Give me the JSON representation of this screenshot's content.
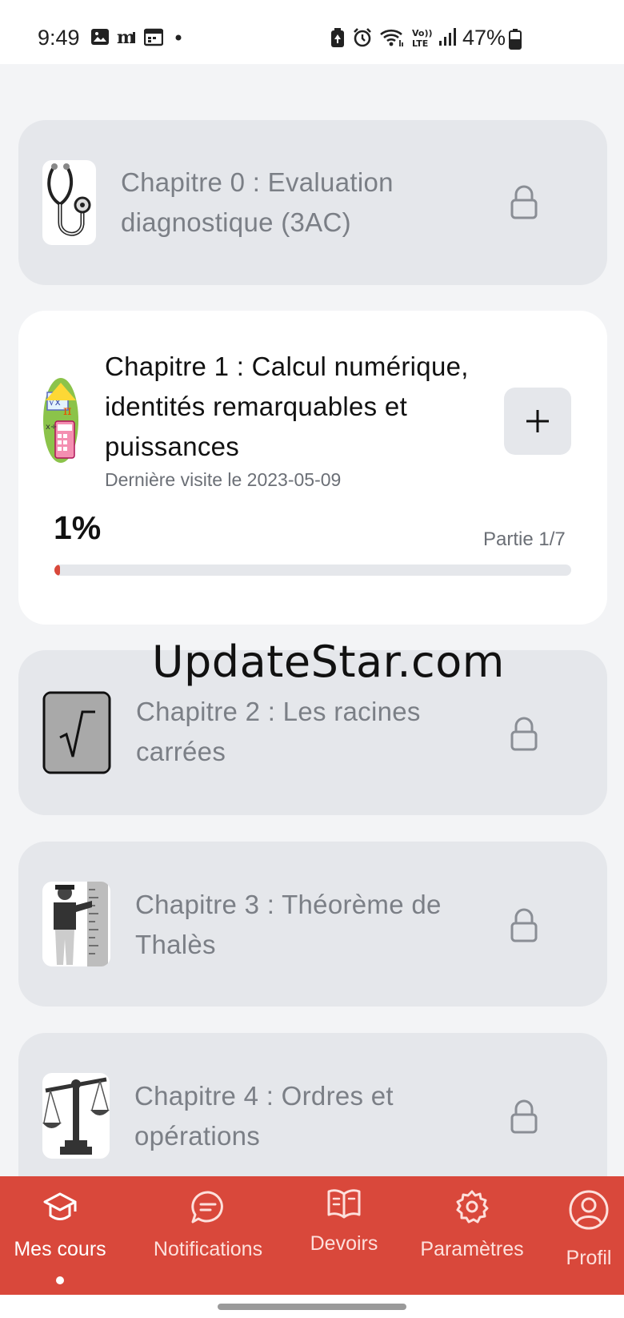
{
  "status_bar": {
    "time": "9:49",
    "battery_percent": "47%"
  },
  "chapters": [
    {
      "title": "Chapitre 0 : Evaluation diagnostique (3AC)",
      "locked": true,
      "icon": "stethoscope-icon"
    },
    {
      "title": "Chapitre 1 : Calcul numérique, identités remarquables et puissances",
      "locked": false,
      "icon": "calculator-math-icon",
      "last_visit": "Dernière visite le 2023-05-09",
      "progress_label": "1%",
      "progress_fraction": 0.01,
      "part_label": "Partie 1/7",
      "action_icon": "plus-icon"
    },
    {
      "title": "Chapitre 2 : Les racines carrées",
      "locked": true,
      "icon": "square-root-icon"
    },
    {
      "title": "Chapitre 3 : Théorème de Thalès",
      "locked": true,
      "icon": "measuring-person-icon"
    },
    {
      "title": "Chapitre 4 : Ordres et opérations",
      "locked": true,
      "icon": "balance-scale-icon"
    }
  ],
  "watermark": "UpdateStar.com",
  "bottom_nav": [
    {
      "label": "Mes cours",
      "icon": "graduation-cap-icon",
      "active": true
    },
    {
      "label": "Notifications",
      "icon": "chat-bubble-icon",
      "active": false
    },
    {
      "label": "Devoirs",
      "icon": "book-icon",
      "active": false
    },
    {
      "label": "Paramètres",
      "icon": "gear-icon",
      "active": false
    },
    {
      "label": "Profil",
      "icon": "user-circle-icon",
      "active": false
    }
  ],
  "colors": {
    "accent": "#d9483b",
    "locked_card": "#e5e7eb",
    "active_card": "#ffffff",
    "background": "#f3f4f6"
  }
}
